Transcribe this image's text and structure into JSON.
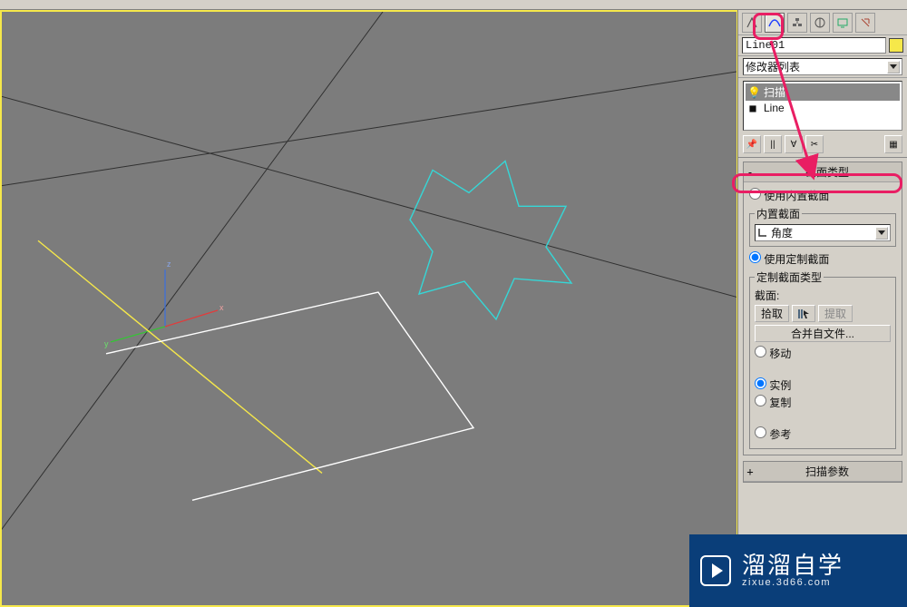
{
  "object": {
    "name": "Line01",
    "color": "#f6e84a"
  },
  "modifierListLabel": "修改器列表",
  "stack": {
    "items": [
      {
        "icon": "💡",
        "label": "扫描",
        "selected": true,
        "expand": ""
      },
      {
        "icon": "■",
        "label": "Line",
        "selected": false,
        "expand": ""
      }
    ]
  },
  "rollouts": {
    "sectionType": {
      "pm": "-",
      "title": "截面类型",
      "useBuiltin": "使用内置截面",
      "builtinLegend": "内置截面",
      "builtinOption": "角度",
      "useCustom": "使用定制截面",
      "customLegend": "定制截面类型",
      "sectionLabel": "截面:",
      "pick": "拾取",
      "extract": "提取",
      "mergeFile": "合并自文件...",
      "move": "移动",
      "instance": "实例",
      "copy": "复制",
      "reference": "参考"
    },
    "sweepParams": {
      "pm": "+",
      "title": "扫描参数"
    }
  },
  "watermark": {
    "brandCn": "溜溜自学",
    "brandEn": "zixue.3d66.com"
  }
}
